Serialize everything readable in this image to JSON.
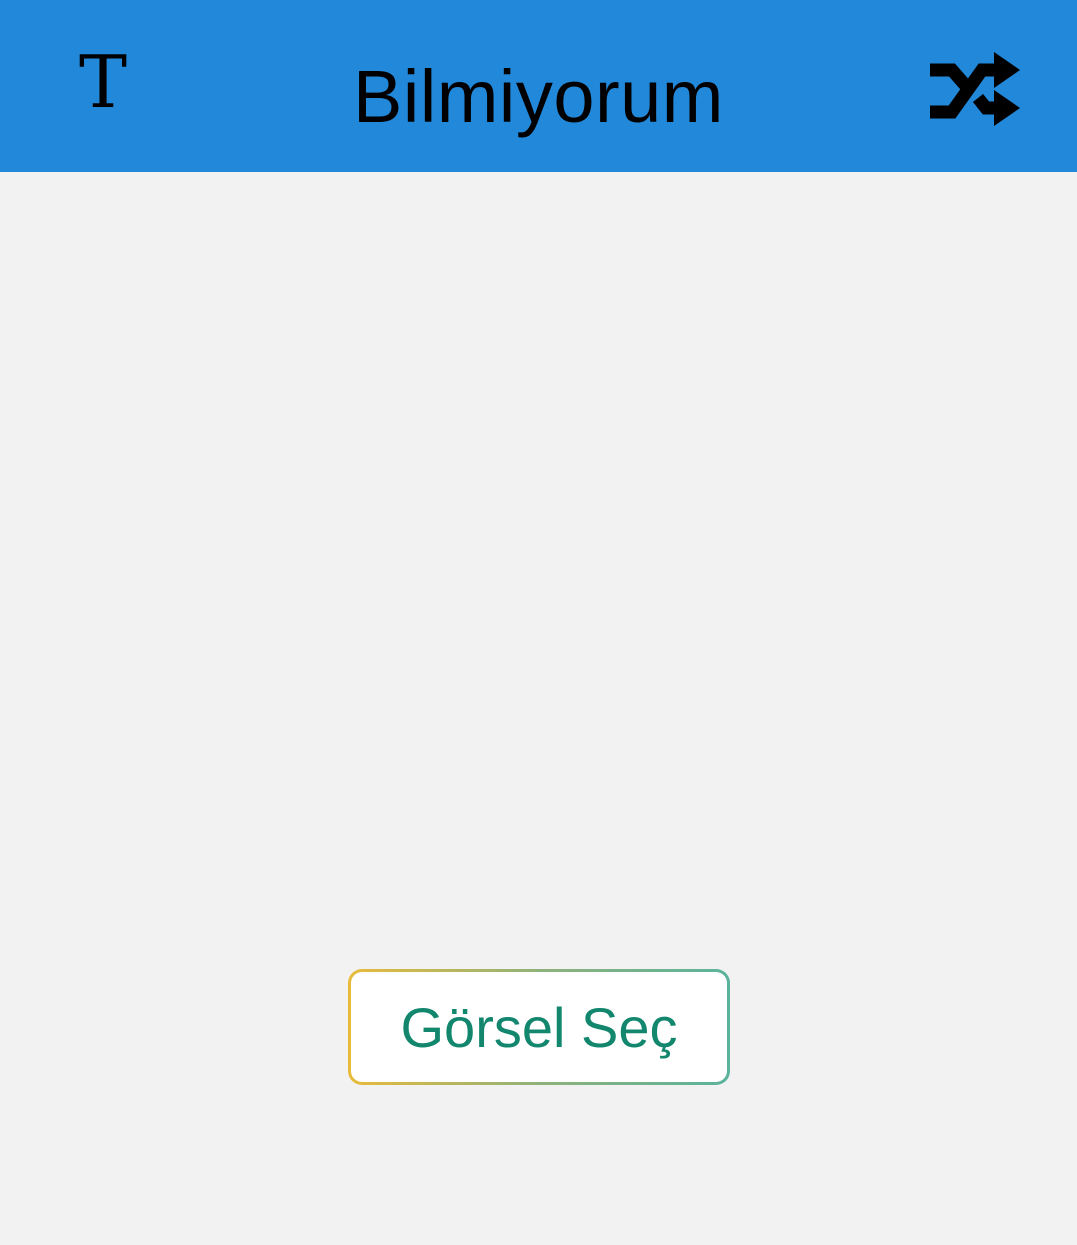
{
  "app_bar": {
    "title": "Bilmiyorum",
    "text_icon_glyph": "T",
    "left_icon": "text-format-icon",
    "right_icon": "shuffle-icon",
    "background_color": "#2288da"
  },
  "main": {
    "select_image_button_label": "Görsel Seç",
    "button_text_color": "#12876d",
    "background_color": "#f2f2f2"
  }
}
